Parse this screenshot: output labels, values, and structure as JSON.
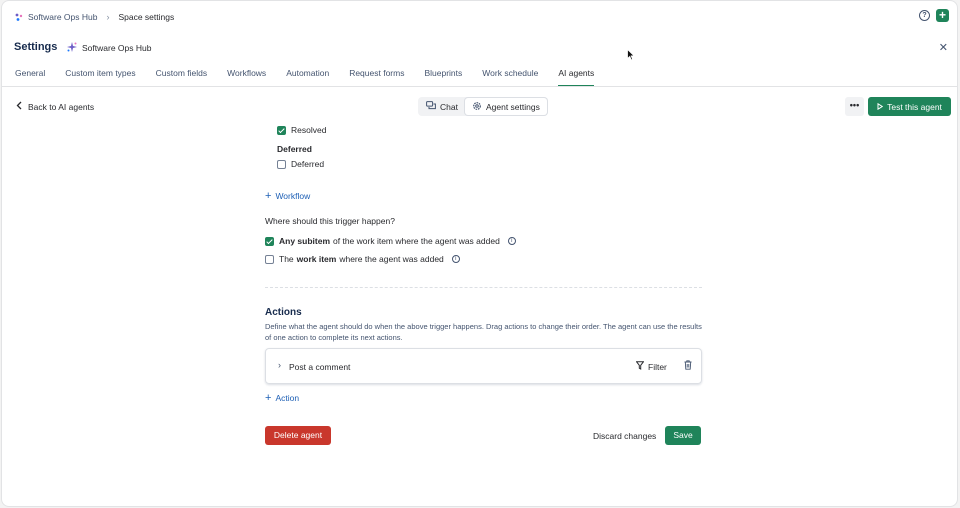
{
  "breadcrumb": {
    "space": "Software Ops Hub",
    "current": "Space settings"
  },
  "header": {
    "title": "Settings",
    "space_name": "Software Ops Hub"
  },
  "tabs": [
    {
      "label": "General"
    },
    {
      "label": "Custom item types"
    },
    {
      "label": "Custom fields"
    },
    {
      "label": "Workflows"
    },
    {
      "label": "Automation"
    },
    {
      "label": "Request forms"
    },
    {
      "label": "Blueprints"
    },
    {
      "label": "Work schedule"
    },
    {
      "label": "AI agents",
      "active": true
    }
  ],
  "subheader": {
    "back_label": "Back to AI agents",
    "chat_label": "Chat",
    "agent_settings_label": "Agent settings",
    "more_label": "•••",
    "test_label": "Test this agent"
  },
  "form": {
    "resolved_label": "Resolved",
    "resolved_checked": true,
    "deferred_group": "Deferred",
    "deferred_label": "Deferred",
    "deferred_checked": false,
    "add_workflow": "Workflow",
    "trigger_question": "Where should this trigger happen?",
    "option1_bold": "Any subitem",
    "option1_rest": "of the work item where the agent was added",
    "option1_checked": true,
    "option2_pre": "The",
    "option2_bold": "work item",
    "option2_rest": "where the agent was added",
    "option2_checked": false
  },
  "actions": {
    "title": "Actions",
    "description": "Define what the agent should do when the above trigger happens. Drag actions to change their order. The agent can use the results of one action to complete its next actions.",
    "items": [
      {
        "name": "Post a comment",
        "filter_label": "Filter"
      }
    ],
    "add_action": "Action"
  },
  "footer": {
    "delete_label": "Delete agent",
    "discard_label": "Discard changes",
    "save_label": "Save"
  },
  "colors": {
    "primary": "#1f845a",
    "danger": "#c9372c",
    "link": "#1d5fb5"
  }
}
